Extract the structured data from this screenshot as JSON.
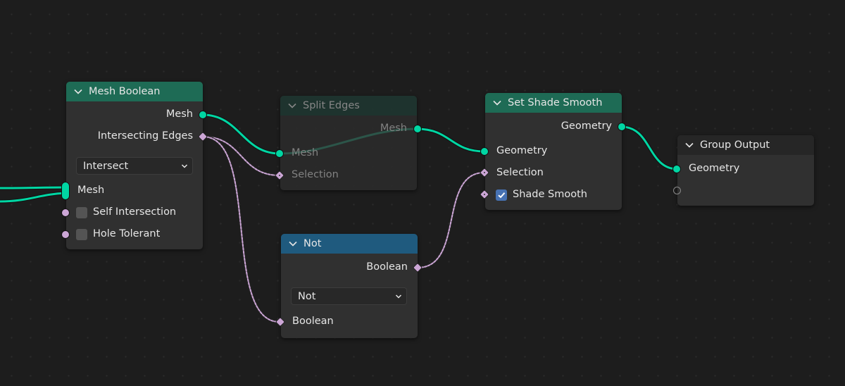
{
  "editor": "Geometry Node Editor",
  "colors": {
    "background": "#1d1d1d",
    "node_body": "#303030",
    "geometry_socket": "#00d6a3",
    "boolean_socket": "#cca6d6",
    "geometry_header": "#1e6b55",
    "mesh_header": "#1e6b55",
    "utility_header": "#1f5a7e",
    "output_header": "#262626",
    "checkbox_checked": "#4772b3"
  },
  "nodes": {
    "mesh_boolean": {
      "title": "Mesh Boolean",
      "outputs": [
        "Mesh",
        "Intersecting Edges"
      ],
      "operation": "Intersect",
      "inputs": {
        "mesh": "Mesh",
        "self_intersection": {
          "label": "Self Intersection",
          "checked": false
        },
        "hole_tolerant": {
          "label": "Hole Tolerant",
          "checked": false
        }
      }
    },
    "split_edges": {
      "title": "Split Edges",
      "muted": true,
      "outputs": [
        "Mesh"
      ],
      "inputs": [
        "Mesh",
        "Selection"
      ]
    },
    "set_shade_smooth": {
      "title": "Set Shade Smooth",
      "outputs": [
        "Geometry"
      ],
      "inputs": {
        "geometry": "Geometry",
        "selection": "Selection",
        "shade_smooth": {
          "label": "Shade Smooth",
          "checked": true
        }
      }
    },
    "group_output": {
      "title": "Group Output",
      "inputs": [
        "Geometry"
      ]
    },
    "not": {
      "title": "Not",
      "outputs": [
        "Boolean"
      ],
      "operation": "Not",
      "inputs": [
        "Boolean"
      ]
    }
  },
  "links": [
    {
      "from": "offscreen",
      "to": "mesh_boolean.mesh",
      "type": "geometry"
    },
    {
      "from": "mesh_boolean.mesh",
      "to": "split_edges.mesh",
      "type": "geometry"
    },
    {
      "from": "mesh_boolean.intersecting_edges",
      "to": "split_edges.selection",
      "type": "boolean"
    },
    {
      "from": "mesh_boolean.intersecting_edges",
      "to": "not.boolean",
      "type": "boolean"
    },
    {
      "from": "split_edges.mesh",
      "to": "set_shade_smooth.geometry",
      "type": "geometry"
    },
    {
      "from": "not.boolean",
      "to": "set_shade_smooth.selection",
      "type": "boolean"
    },
    {
      "from": "set_shade_smooth.geometry",
      "to": "group_output.geometry",
      "type": "geometry"
    }
  ]
}
